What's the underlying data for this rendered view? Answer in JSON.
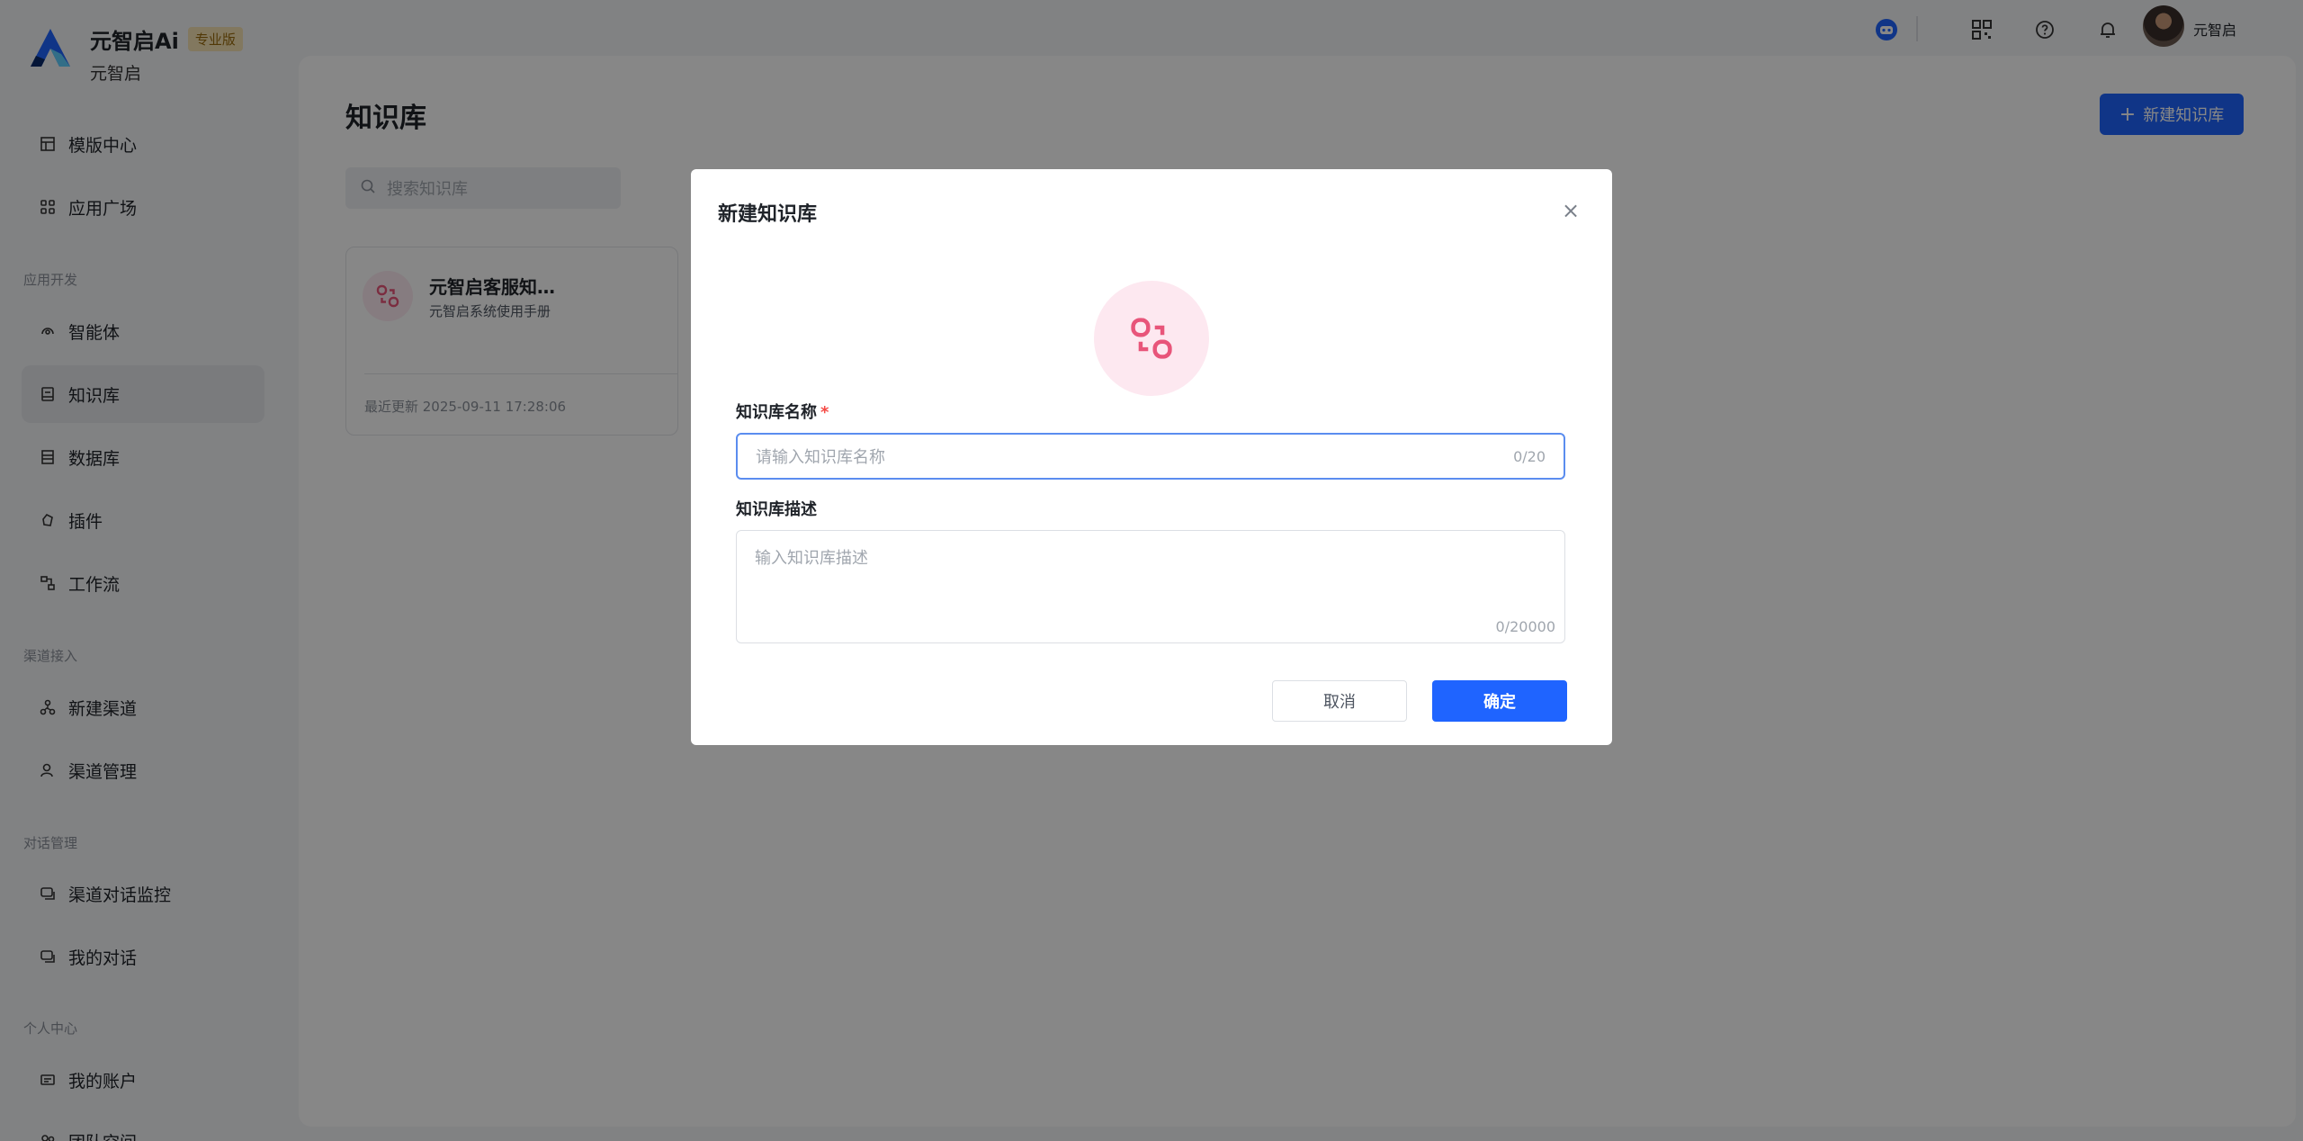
{
  "brand": {
    "name": "元智启Ai",
    "badge": "专业版",
    "subtitle": "元智启"
  },
  "sidebar": {
    "items": [
      {
        "label": "模版中心",
        "icon": "template-icon"
      },
      {
        "label": "应用广场",
        "icon": "grid-icon"
      },
      {
        "label": "智能体",
        "icon": "agent-icon"
      },
      {
        "label": "知识库",
        "icon": "knowledge-icon"
      },
      {
        "label": "数据库",
        "icon": "database-icon"
      },
      {
        "label": "插件",
        "icon": "plugin-icon"
      },
      {
        "label": "工作流",
        "icon": "workflow-icon"
      },
      {
        "label": "新建渠道",
        "icon": "channel-icon"
      },
      {
        "label": "渠道管理",
        "icon": "channel-manage-icon"
      },
      {
        "label": "渠道对话监控",
        "icon": "chat-icon"
      },
      {
        "label": "我的对话",
        "icon": "chat-icon"
      },
      {
        "label": "我的账户",
        "icon": "account-icon"
      },
      {
        "label": "团队空间",
        "icon": "team-icon"
      }
    ],
    "sections": [
      "应用开发",
      "渠道接入",
      "对话管理",
      "个人中心"
    ],
    "active": "知识库"
  },
  "topbar": {
    "username": "元智启"
  },
  "main": {
    "title": "知识库",
    "new_button": "新建知识库",
    "search_placeholder": "搜索知识库",
    "card": {
      "title": "元智启客服知…",
      "description": "元智启系统使用手册",
      "updated": "最近更新 2025-09-11 17:28:06"
    }
  },
  "modal": {
    "title": "新建知识库",
    "name_label": "知识库名称",
    "required_mark": "*",
    "name_placeholder": "请输入知识库名称",
    "name_counter": "0/20",
    "desc_label": "知识库描述",
    "desc_placeholder": "输入知识库描述",
    "desc_counter": "0/20000",
    "cancel": "取消",
    "confirm": "确定"
  },
  "colors": {
    "accent": "#1f64ff",
    "overlay": "rgba(0,0,0,0.47)",
    "pink": "#e8557a"
  }
}
